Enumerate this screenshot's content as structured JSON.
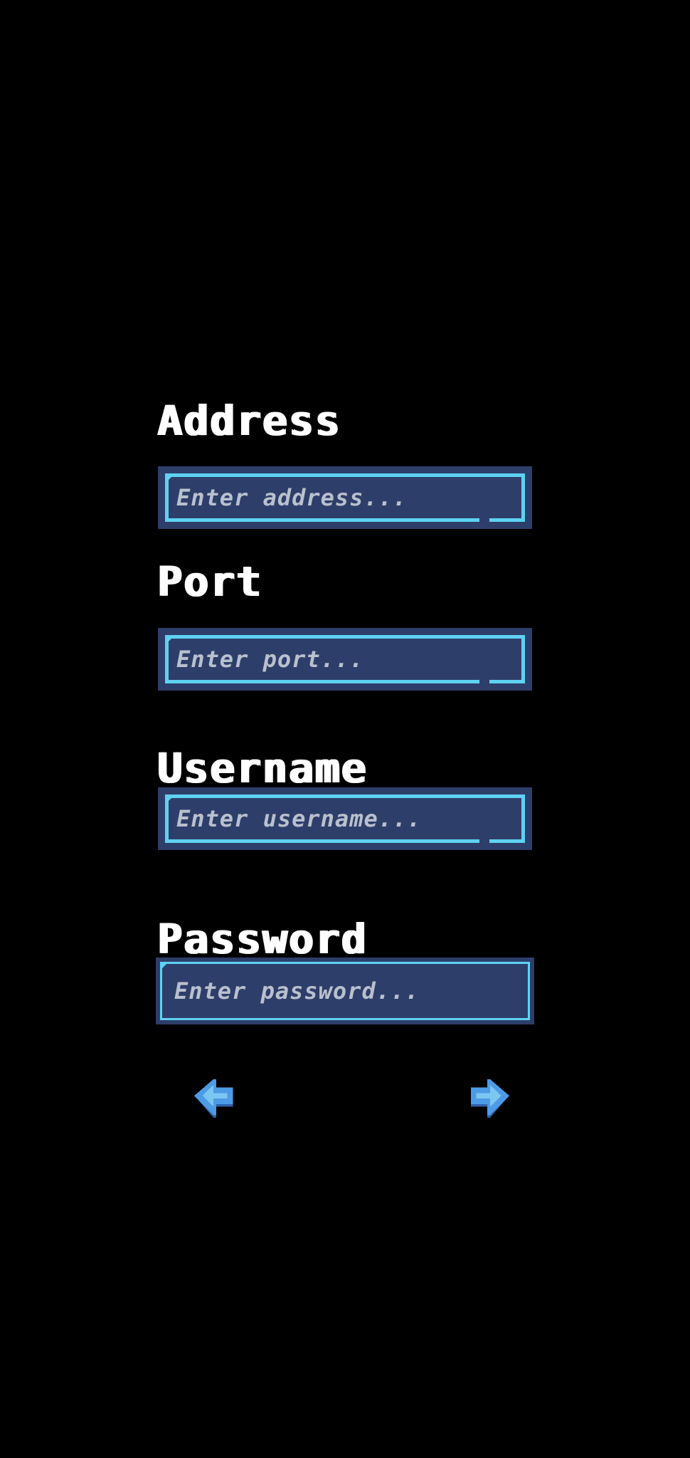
{
  "form": {
    "address": {
      "label": "Address",
      "placeholder": "Enter address...",
      "value": ""
    },
    "port": {
      "label": "Port",
      "placeholder": "Enter port...",
      "value": ""
    },
    "username": {
      "label": "Username",
      "placeholder": "Enter username...",
      "value": ""
    },
    "password": {
      "label": "Password",
      "placeholder": "Enter password...",
      "value": ""
    }
  },
  "navigation": {
    "back_icon": "arrow-left-icon",
    "next_icon": "arrow-right-icon"
  },
  "colors": {
    "background": "#000000",
    "label_text": "#ffffff",
    "field_fill": "#2e3e6a",
    "field_border": "#5ed2f2",
    "placeholder_text": "#b9c0ce",
    "arrow_fill": "#4d9be6",
    "arrow_shade": "#2f5fa8"
  }
}
